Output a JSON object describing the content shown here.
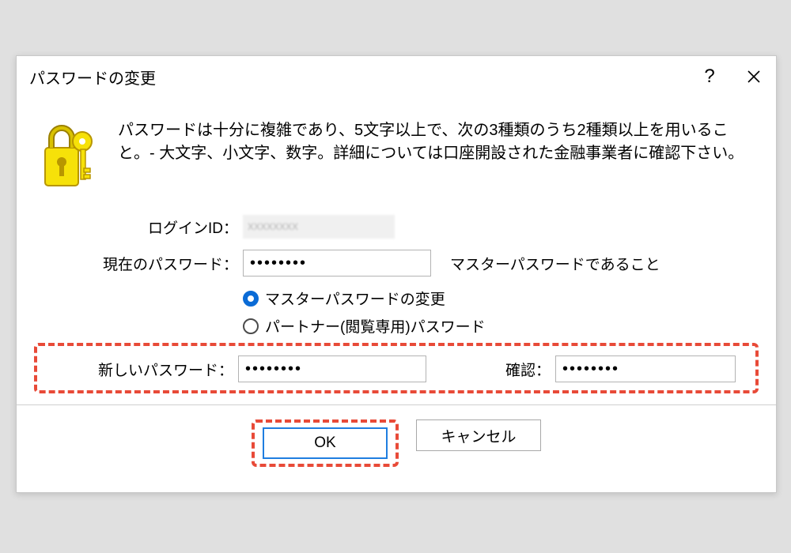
{
  "dialog": {
    "title": "パスワードの変更",
    "instructions": "パスワードは十分に複雑であり、5文字以上で、次の3種類のうち2種類以上を用いること。- 大文字、小文字、数字。詳細については口座開設された金融事業者に確認下さい。",
    "login_id_label": "ログインID：",
    "login_id_value": "xxxxxxxx",
    "current_pw_label": "現在のパスワード：",
    "current_pw_value": "••••••••",
    "current_pw_hint": "マスターパスワードであること",
    "radio_master": "マスターパスワードの変更",
    "radio_partner": "パートナー(閲覧専用)パスワード",
    "new_pw_label": "新しいパスワード：",
    "new_pw_value": "••••••••",
    "confirm_label": "確認：",
    "confirm_value": "••••••••",
    "ok_label": "OK",
    "cancel_label": "キャンセル"
  }
}
